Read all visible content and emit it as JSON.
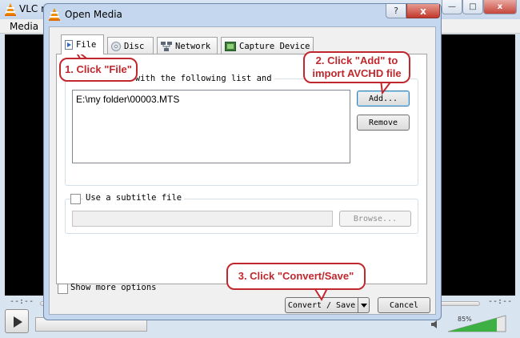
{
  "vlc": {
    "title": "VLC m",
    "menu_media": "Media",
    "time_left": "--:--",
    "time_right": "--:--",
    "volume": "85%"
  },
  "dialog": {
    "title": "Open Media",
    "help_label": "?",
    "close_label": "x",
    "tabs": [
      {
        "label": "File",
        "icon": "file-icon"
      },
      {
        "label": "Disc",
        "icon": "disc-icon"
      },
      {
        "label": "Network",
        "icon": "network-icon"
      },
      {
        "label": "Capture Device",
        "icon": "capture-device-icon"
      }
    ],
    "files_description": "local files with the following list and",
    "file_list": [
      "E:\\my folder\\00003.MTS"
    ],
    "add_label": "Add...",
    "remove_label": "Remove",
    "subtitle_label": "Use a subtitle file",
    "browse_label": "Browse...",
    "show_more_label": "Show more options",
    "convert_label": "Convert / Save",
    "cancel_label": "Cancel"
  },
  "callouts": {
    "step1": "1. Click \"File\"",
    "step2_line1": "2. Click \"Add\" to",
    "step2_line2": "import AVCHD file",
    "step3": "3. Click \"Convert/Save\""
  },
  "colors": {
    "callout": "#c0282d",
    "accent_button_border": "#3c7fb1",
    "title_bar": "#c5d7ee"
  }
}
